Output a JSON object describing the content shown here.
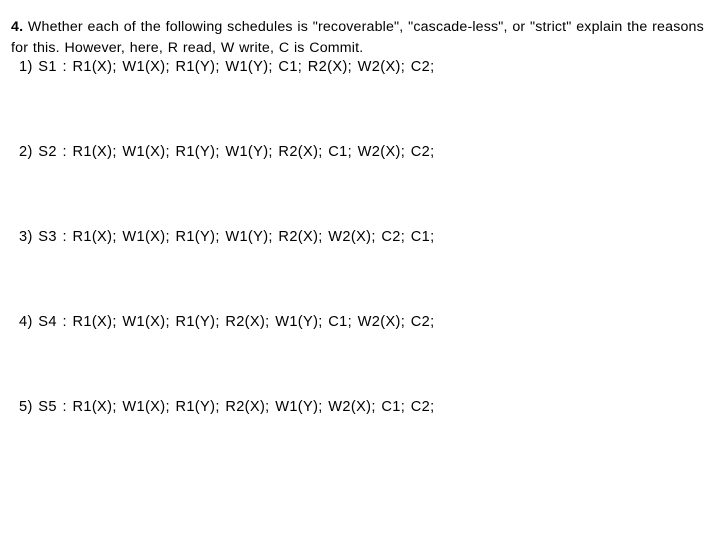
{
  "slide": {
    "background_color": "#ffffff",
    "text_color": "#000000"
  },
  "question": {
    "number": "4.",
    "text": " Whether each of the following schedules is \"recoverable\", \"cascade-less\", or \"strict\" explain the reasons for this. However, here, R read, W write, C is Commit."
  },
  "schedules": [
    {
      "index": "1)",
      "name": "S1",
      "separator": ":",
      "operations": "R1(X); W1(X); R1(Y); W1(Y); C1; R2(X); W2(X); C2;",
      "full_line": "1) S1 : R1(X); W1(X); R1(Y); W1(Y); C1; R2(X); W2(X); C2;"
    },
    {
      "index": "2)",
      "name": "S2",
      "separator": ":",
      "operations": "R1(X); W1(X); R1(Y); W1(Y); R2(X); C1; W2(X); C2;",
      "full_line": "2) S2 : R1(X); W1(X); R1(Y); W1(Y); R2(X); C1; W2(X); C2;"
    },
    {
      "index": "3)",
      "name": "S3",
      "separator": ":",
      "operations": "R1(X); W1(X); R1(Y); W1(Y); R2(X); W2(X); C2; C1;",
      "full_line": "3) S3 : R1(X); W1(X); R1(Y); W1(Y); R2(X); W2(X); C2; C1;"
    },
    {
      "index": "4)",
      "name": "S4",
      "separator": ":",
      "operations": "R1(X); W1(X); R1(Y); R2(X); W1(Y); C1; W2(X); C2;",
      "full_line": "4) S4 : R1(X); W1(X); R1(Y); R2(X); W1(Y); C1; W2(X); C2;"
    },
    {
      "index": "5)",
      "name": "S5",
      "separator": ":",
      "operations": "R1(X); W1(X); R1(Y); R2(X); W1(Y); W2(X); C1; C2;",
      "full_line": "5) S5 : R1(X); W1(X); R1(Y); R2(X); W1(Y); W2(X); C1; C2;"
    }
  ]
}
